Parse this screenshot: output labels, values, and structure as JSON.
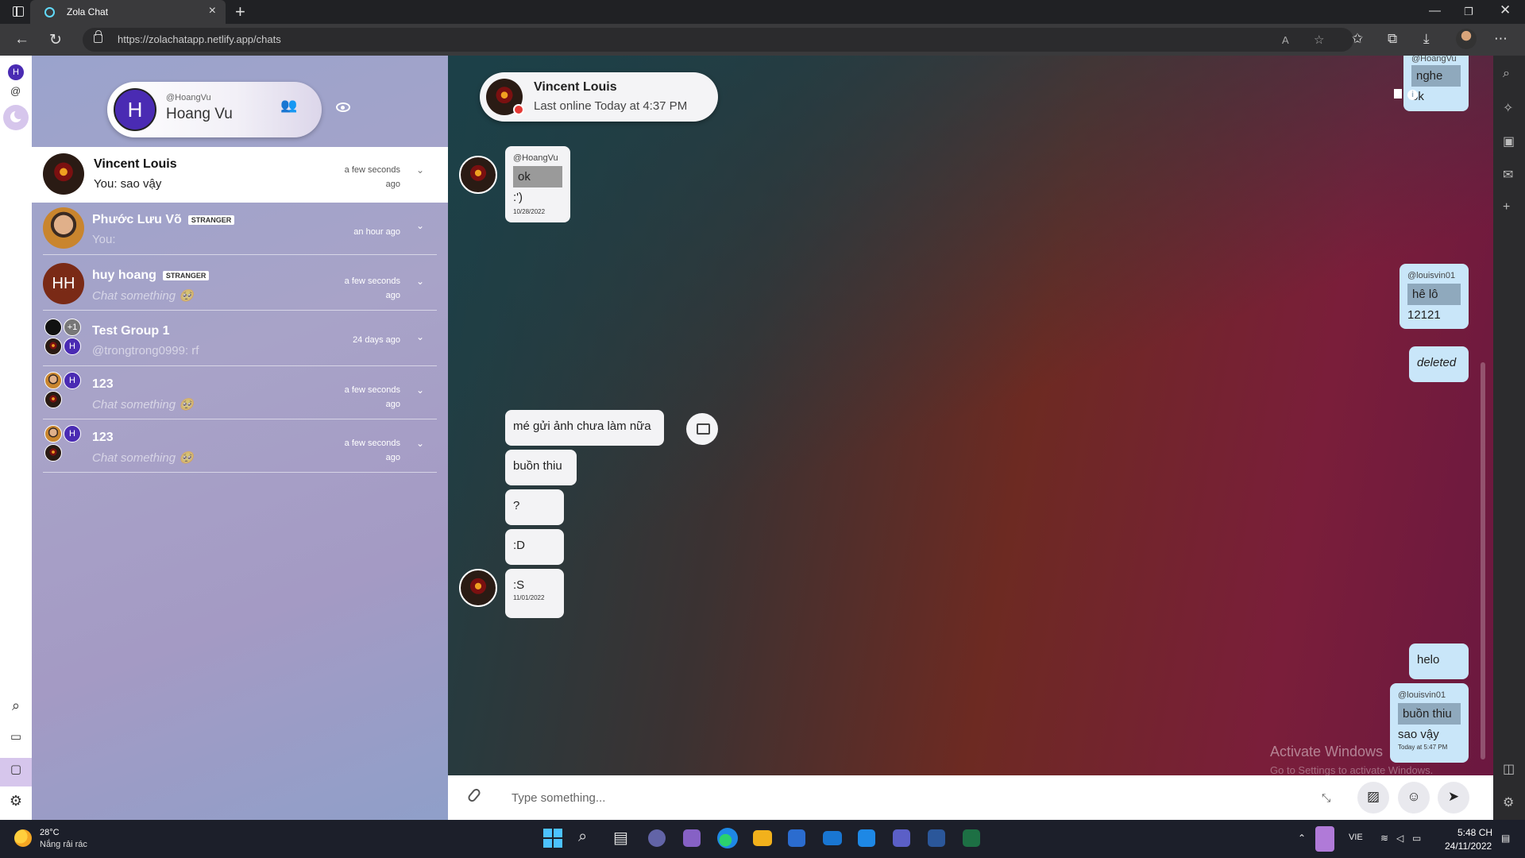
{
  "browser": {
    "tab_title": "Zola Chat",
    "url": "https://zolachatapp.netlify.app/chats"
  },
  "me": {
    "avatar_letter": "H",
    "handle": "@HoangVu",
    "name": "Hoang Vu"
  },
  "rail": {
    "avatar_letter": "H",
    "at_symbol": "@"
  },
  "conversations": [
    {
      "name": "Vincent Louis",
      "badge": "",
      "last": "You: sao vậy",
      "time": "a few seconds ago"
    },
    {
      "name": "Phước Lưu Võ",
      "badge": "STRANGER",
      "last": "You:",
      "time": "an hour ago"
    },
    {
      "name": "huy hoang",
      "badge": "STRANGER",
      "initials": "HH",
      "last": "Chat something 🥺",
      "time": "a few seconds ago"
    },
    {
      "name": "Test Group 1",
      "badge": "",
      "extra": "+1",
      "member_letter": "H",
      "last": "@trongtrong0999: rf",
      "time": "24 days ago"
    },
    {
      "name": "123",
      "badge": "",
      "member_letter": "H",
      "last": "Chat something 🥺",
      "time": "a few seconds ago"
    },
    {
      "name": "123",
      "badge": "",
      "member_letter": "H",
      "last": "Chat something 🥺",
      "time": "a few seconds ago"
    }
  ],
  "chat_header": {
    "name": "Vincent Louis",
    "status": "Last online Today at 4:37 PM"
  },
  "messages": {
    "top_right": {
      "handle": "@HoangVu",
      "quote": "nghe",
      "text": "ok"
    },
    "m1": {
      "handle": "@HoangVu",
      "quote": "ok",
      "text": ":')",
      "date": "10/28/2022"
    },
    "m2": {
      "handle": "@louisvin01",
      "quote": "hê lô",
      "text": "12121"
    },
    "m3": {
      "text": "deleted"
    },
    "m4": {
      "text": "mé gửi ảnh chưa làm nữa"
    },
    "m5": {
      "text": "buồn thiu"
    },
    "m6": {
      "text": "?"
    },
    "m7": {
      "text": ":D"
    },
    "m8": {
      "text": ":S",
      "date": "11/01/2022"
    },
    "m9": {
      "text": "helo"
    },
    "m10": {
      "handle": "@louisvin01",
      "quote": "buồn thiu",
      "text": "sao vậy",
      "date": "Today at 5:47 PM"
    }
  },
  "watermark": {
    "title": "Activate Windows",
    "sub": "Go to Settings to activate Windows."
  },
  "composer": {
    "placeholder": "Type something..."
  },
  "taskbar": {
    "temp": "28°C",
    "weather": "Nắng rải rác",
    "lang": "VIE",
    "time": "5:48 CH",
    "date": "24/11/2022"
  }
}
